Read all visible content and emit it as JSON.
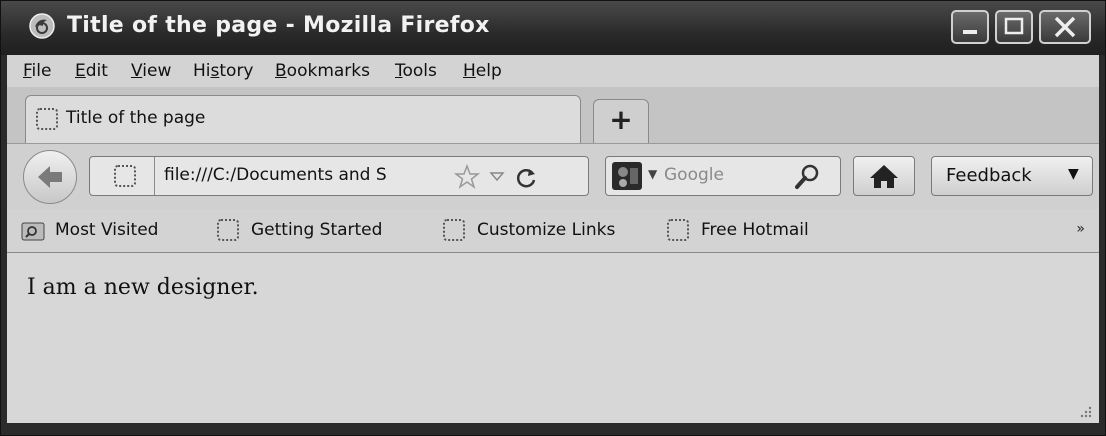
{
  "window": {
    "title": "Title of the page - Mozilla Firefox"
  },
  "menu": {
    "items": [
      {
        "label": "File",
        "accel": "F",
        "rest": "ile"
      },
      {
        "label": "Edit",
        "accel": "E",
        "rest": "dit"
      },
      {
        "label": "View",
        "accel": "V",
        "rest": "iew"
      },
      {
        "label": "History",
        "pre": "Hi",
        "accel": "s",
        "rest": "tory"
      },
      {
        "label": "Bookmarks",
        "accel": "B",
        "rest": "ookmarks"
      },
      {
        "label": "Tools",
        "accel": "T",
        "rest": "ools"
      },
      {
        "label": "Help",
        "accel": "H",
        "rest": "elp"
      }
    ]
  },
  "tabs": {
    "active_label": "Title of the page",
    "new_tab_label": "+"
  },
  "navbar": {
    "url": "file:///C:/Documents and S",
    "search_placeholder": "Google",
    "feedback_label": "Feedback"
  },
  "bookmarks": {
    "items": [
      {
        "label": "Most Visited"
      },
      {
        "label": "Getting Started"
      },
      {
        "label": "Customize Links"
      },
      {
        "label": "Free Hotmail"
      }
    ],
    "overflow": "»"
  },
  "content": {
    "text": "I am a new designer."
  }
}
